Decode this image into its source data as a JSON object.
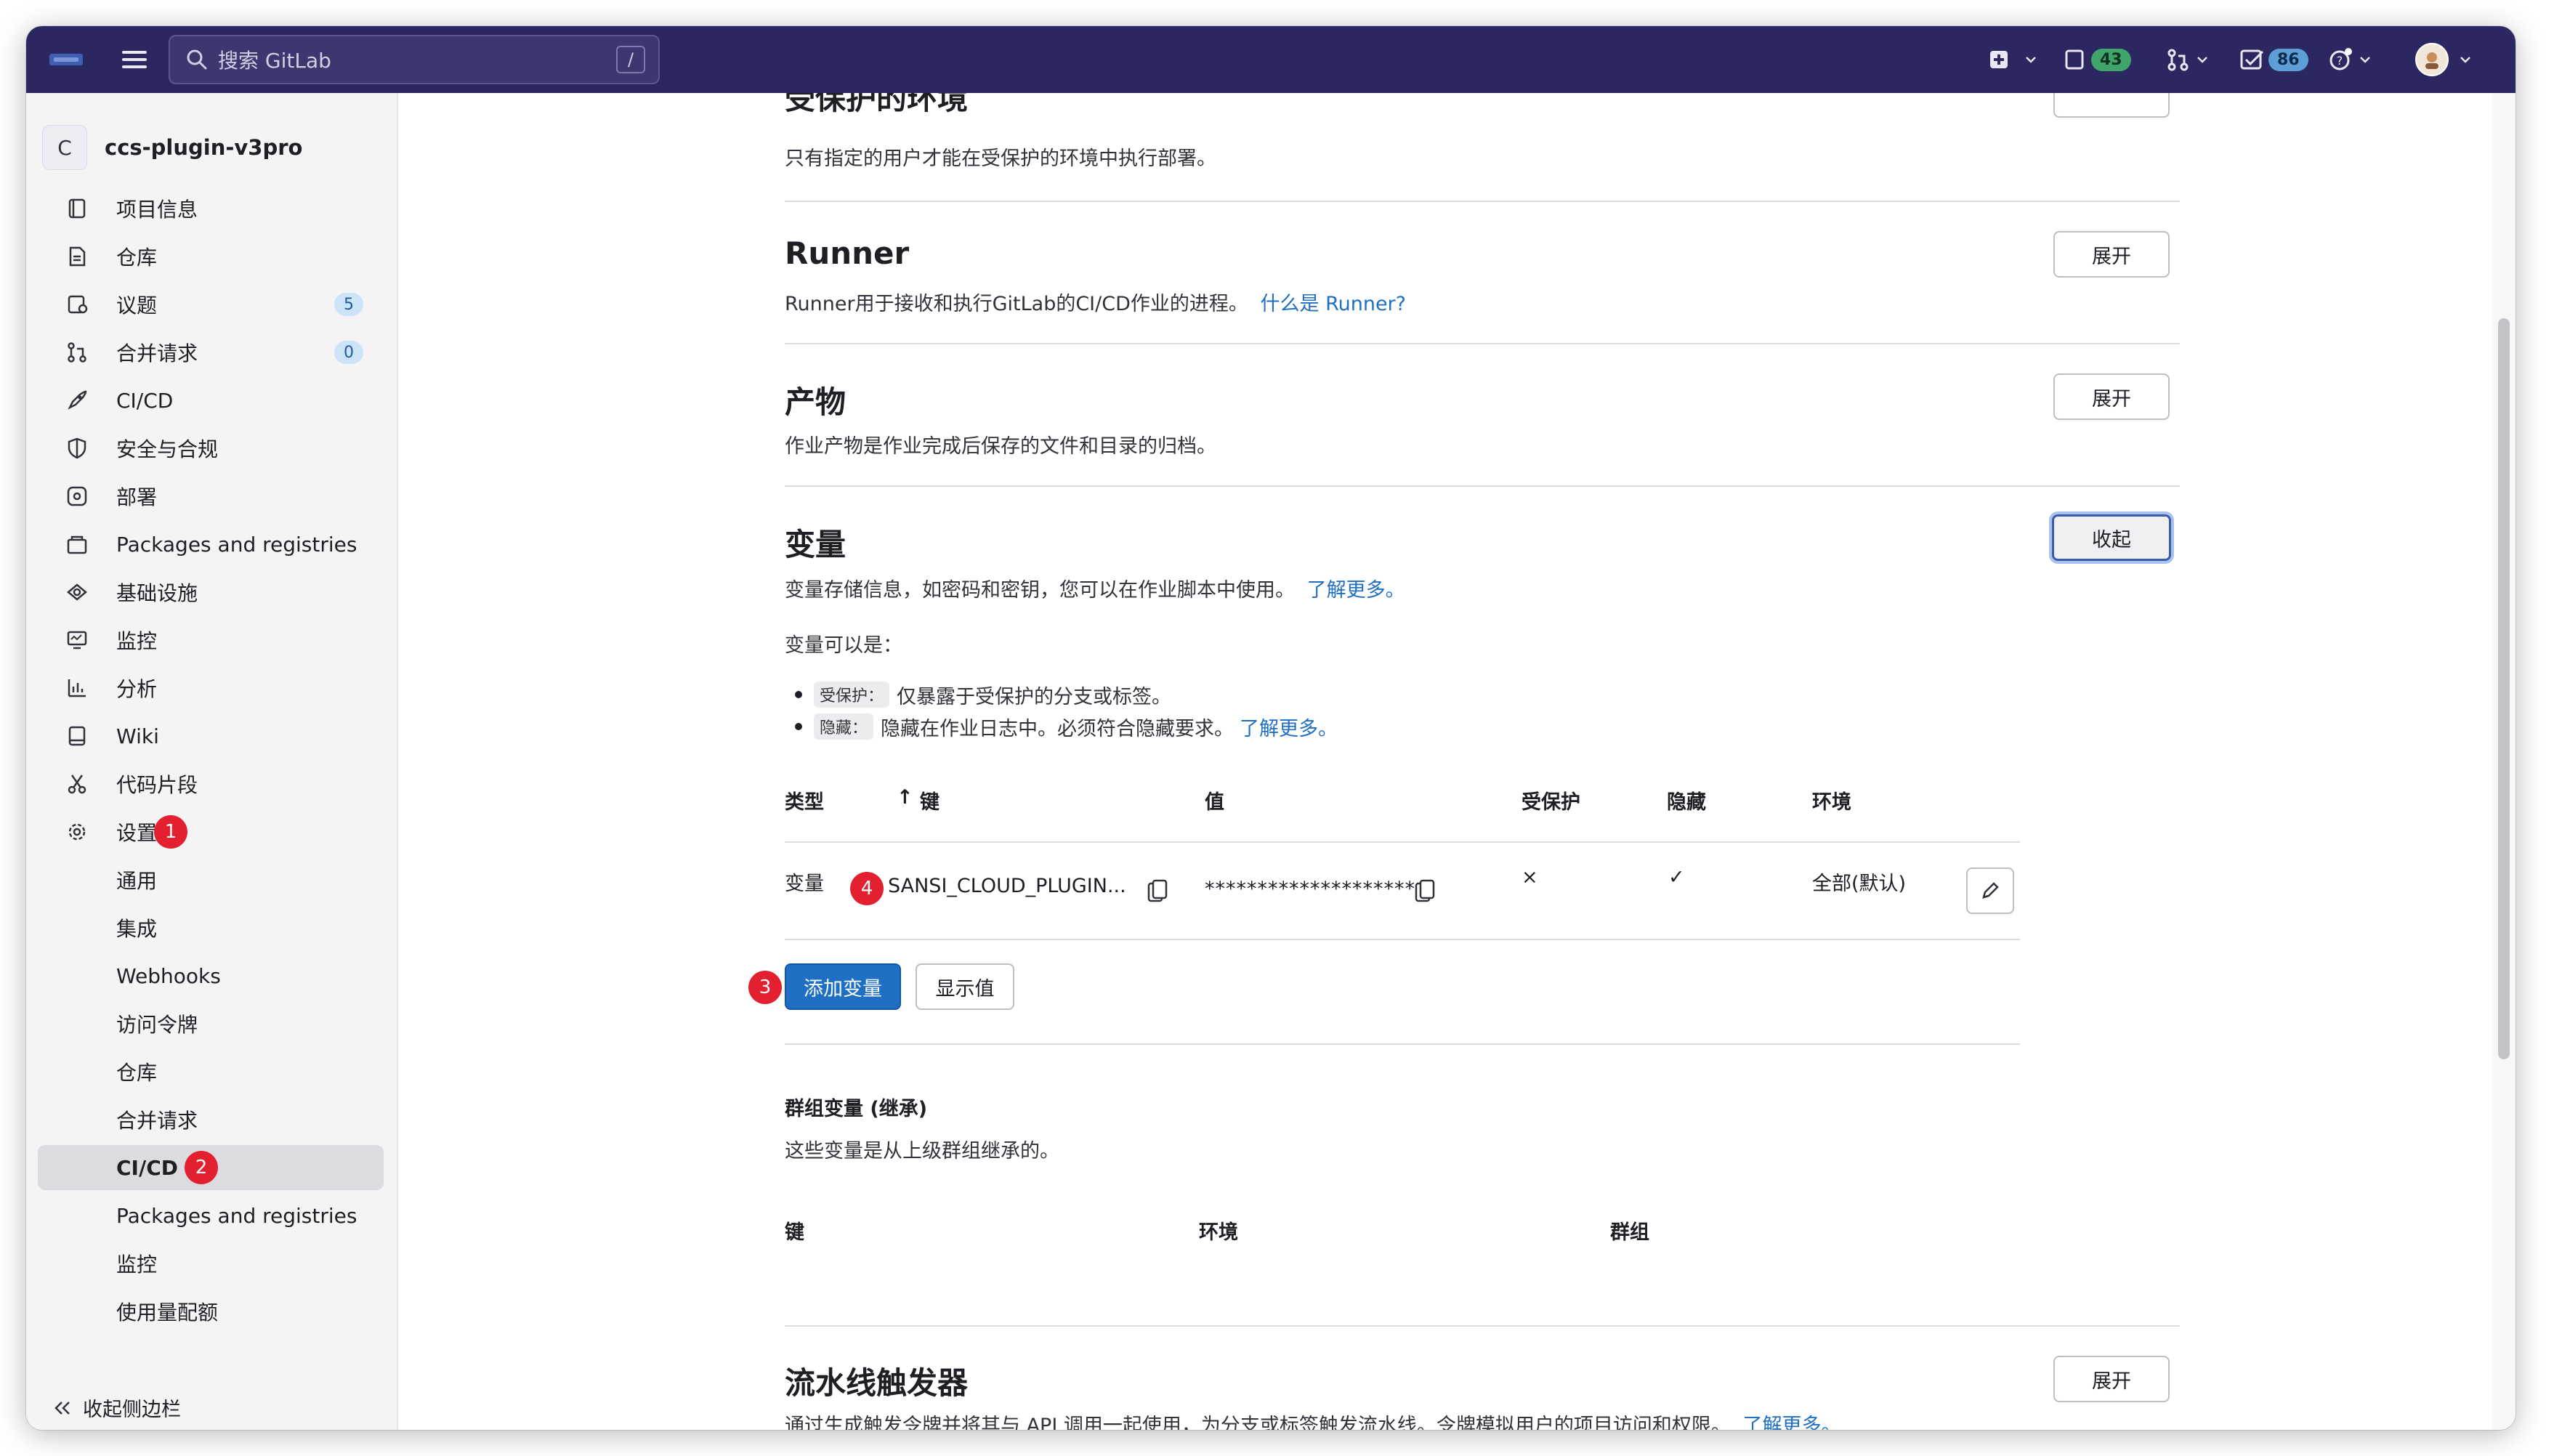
{
  "topbar": {
    "search_placeholder": "搜索 GitLab",
    "search_shortcut": "/",
    "issues_count": "43",
    "todos_count": "86"
  },
  "sidebar": {
    "project_initial": "C",
    "project_name": "ccs-plugin-v3pro",
    "items": [
      {
        "label": "项目信息",
        "icon": "project-info-icon"
      },
      {
        "label": "仓库",
        "icon": "repository-icon"
      },
      {
        "label": "议题",
        "icon": "issues-icon",
        "count": "5"
      },
      {
        "label": "合并请求",
        "icon": "merge-request-icon",
        "count": "0"
      },
      {
        "label": "CI/CD",
        "icon": "rocket-icon"
      },
      {
        "label": "安全与合规",
        "icon": "shield-icon"
      },
      {
        "label": "部署",
        "icon": "deployments-icon"
      },
      {
        "label": "Packages and registries",
        "icon": "package-icon"
      },
      {
        "label": "基础设施",
        "icon": "cloud-gear-icon"
      },
      {
        "label": "监控",
        "icon": "monitor-icon"
      },
      {
        "label": "分析",
        "icon": "chart-icon"
      },
      {
        "label": "Wiki",
        "icon": "book-icon"
      },
      {
        "label": "代码片段",
        "icon": "snippet-icon"
      },
      {
        "label": "设置",
        "icon": "settings-icon"
      }
    ],
    "sub_items": [
      "通用",
      "集成",
      "Webhooks",
      "访问令牌",
      "仓库",
      "合并请求",
      "CI/CD",
      "Packages and registries",
      "监控",
      "使用量配额"
    ],
    "collapse_label": "收起侧边栏",
    "markers": {
      "settings": "1",
      "cicd": "2"
    }
  },
  "main": {
    "protected_env": {
      "title": "受保护的环境",
      "desc": "只有指定的用户才能在受保护的环境中执行部署。"
    },
    "runner": {
      "title": "Runner",
      "desc": "Runner用于接收和执行GitLab的CI/CD作业的进程。",
      "link": "什么是 Runner?",
      "button": "展开"
    },
    "artifacts": {
      "title": "产物",
      "desc": "作业产物是作业完成后保存的文件和目录的归档。",
      "button": "展开"
    },
    "variables": {
      "title": "变量",
      "desc": "变量存储信息，如密码和密钥，您可以在作业脚本中使用。",
      "link": "了解更多。",
      "button": "收起",
      "can_be": "变量可以是：",
      "bullets": [
        {
          "tag": "受保护：",
          "text": "仅暴露于受保护的分支或标签。",
          "link": ""
        },
        {
          "tag": "隐藏：",
          "text": "隐藏在作业日志中。必须符合隐藏要求。",
          "link": "了解更多。"
        }
      ],
      "table_headers": {
        "type": "类型",
        "sort": "↑",
        "key": "键",
        "value": "值",
        "protected": "受保护",
        "masked": "隐藏",
        "environment": "环境"
      },
      "row": {
        "type": "变量",
        "key": "SANSI_CLOUD_PLUGIN...",
        "value": "********************",
        "protected": "×",
        "masked": "✓",
        "environment": "全部(默认)"
      },
      "add_button": "添加变量",
      "reveal_button": "显示值",
      "markers": {
        "add": "3",
        "key": "4"
      }
    },
    "group_vars": {
      "title": "群组变量 (继承)",
      "desc": "这些变量是从上级群组继承的。",
      "headers": {
        "key": "键",
        "environment": "环境",
        "group": "群组"
      }
    },
    "triggers": {
      "title": "流水线触发器",
      "desc": "通过生成触发令牌并将其与 API 调用一起使用，为分支或标签触发流水线。令牌模拟用户的项目访问和权限。",
      "link": "了解更多。",
      "button": "展开"
    }
  }
}
